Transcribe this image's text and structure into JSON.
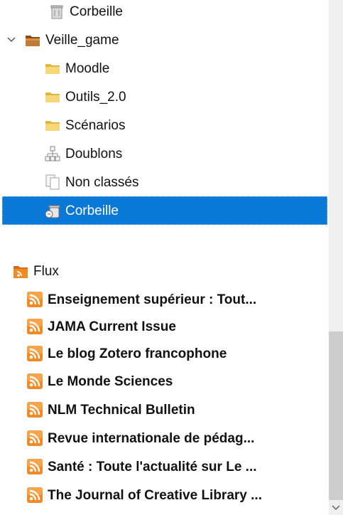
{
  "tree": {
    "library": {
      "top_trash_label": "Corbeille",
      "group_label": "Veille_game",
      "group_expanded": true,
      "items": [
        {
          "label": "Moodle",
          "icon": "folder-icon"
        },
        {
          "label": "Outils_2.0",
          "icon": "folder-icon"
        },
        {
          "label": "Scénarios",
          "icon": "folder-icon"
        },
        {
          "label": "Doublons",
          "icon": "duplicates-icon"
        },
        {
          "label": "Non classés",
          "icon": "unfiled-icon"
        },
        {
          "label": "Corbeille",
          "icon": "trash-icon",
          "selected": true
        }
      ]
    },
    "feeds": {
      "label": "Flux",
      "items": [
        {
          "label": "Enseignement supérieur : Tout..."
        },
        {
          "label": "JAMA Current Issue"
        },
        {
          "label": "Le blog Zotero francophone"
        },
        {
          "label": "Le Monde Sciences"
        },
        {
          "label": "NLM Technical Bulletin"
        },
        {
          "label": "Revue internationale de pédag..."
        },
        {
          "label": "Santé : Toute l'actualité sur Le ..."
        },
        {
          "label": "The Journal of Creative Library ..."
        }
      ]
    }
  },
  "colors": {
    "selection": "#0a78d7",
    "feed_orange": "#f08a24",
    "folder_yellow": "#f4cf5f",
    "group_brown": "#b06a2a"
  }
}
